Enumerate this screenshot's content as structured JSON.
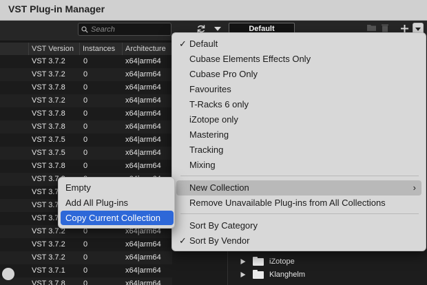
{
  "window": {
    "title": "VST Plug-in Manager"
  },
  "toolbar": {
    "search_placeholder": "Search",
    "collection_value": "Default"
  },
  "table": {
    "columns": [
      "VST Version",
      "Instances",
      "Architecture"
    ],
    "rows": [
      [
        "VST 3.7.2",
        "0",
        "x64|arm64"
      ],
      [
        "VST 3.7.2",
        "0",
        "x64|arm64"
      ],
      [
        "VST 3.7.8",
        "0",
        "x64|arm64"
      ],
      [
        "VST 3.7.2",
        "0",
        "x64|arm64"
      ],
      [
        "VST 3.7.8",
        "0",
        "x64|arm64"
      ],
      [
        "VST 3.7.8",
        "0",
        "x64|arm64"
      ],
      [
        "VST 3.7.5",
        "0",
        "x64|arm64"
      ],
      [
        "VST 3.7.5",
        "0",
        "x64|arm64"
      ],
      [
        "VST 3.7.8",
        "0",
        "x64|arm64"
      ],
      [
        "VST 3.7.2",
        "0",
        "x64|arm64"
      ],
      [
        "VST 3.7.2",
        "0",
        "x64|arm64"
      ],
      [
        "VST 3.7.2",
        "0",
        "x64|arm64"
      ],
      [
        "VST 3.7.2",
        "0",
        "x64|arm64"
      ],
      [
        "VST 3.7.2",
        "0",
        "x64|arm64"
      ],
      [
        "VST 3.7.2",
        "0",
        "x64|arm64"
      ],
      [
        "VST 3.7.2",
        "0",
        "x64|arm64"
      ],
      [
        "VST 3.7.1",
        "0",
        "x64|arm64"
      ],
      [
        "VST 3.7.8",
        "0",
        "x64|arm64"
      ]
    ]
  },
  "tree": {
    "items": [
      "iZotope",
      "Klanghelm"
    ]
  },
  "menu": {
    "collections": [
      "Default",
      "Cubase Elements Effects Only",
      "Cubase Pro Only",
      "Favourites",
      "T-Racks 6 only",
      "iZotope only",
      "Mastering",
      "Tracking",
      "Mixing"
    ],
    "checked_collection": "Default",
    "new_collection": "New Collection",
    "remove_unavailable": "Remove Unavailable Plug-ins from All Collections",
    "sort_by_category": "Sort By Category",
    "sort_by_vendor": "Sort By Vendor",
    "checked_sort": "Sort By Vendor"
  },
  "submenu": {
    "items": [
      "Empty",
      "Add All Plug-ins",
      "Copy Current Collection"
    ],
    "selected": "Copy Current Collection",
    "selected_color": "#2e68d8"
  }
}
